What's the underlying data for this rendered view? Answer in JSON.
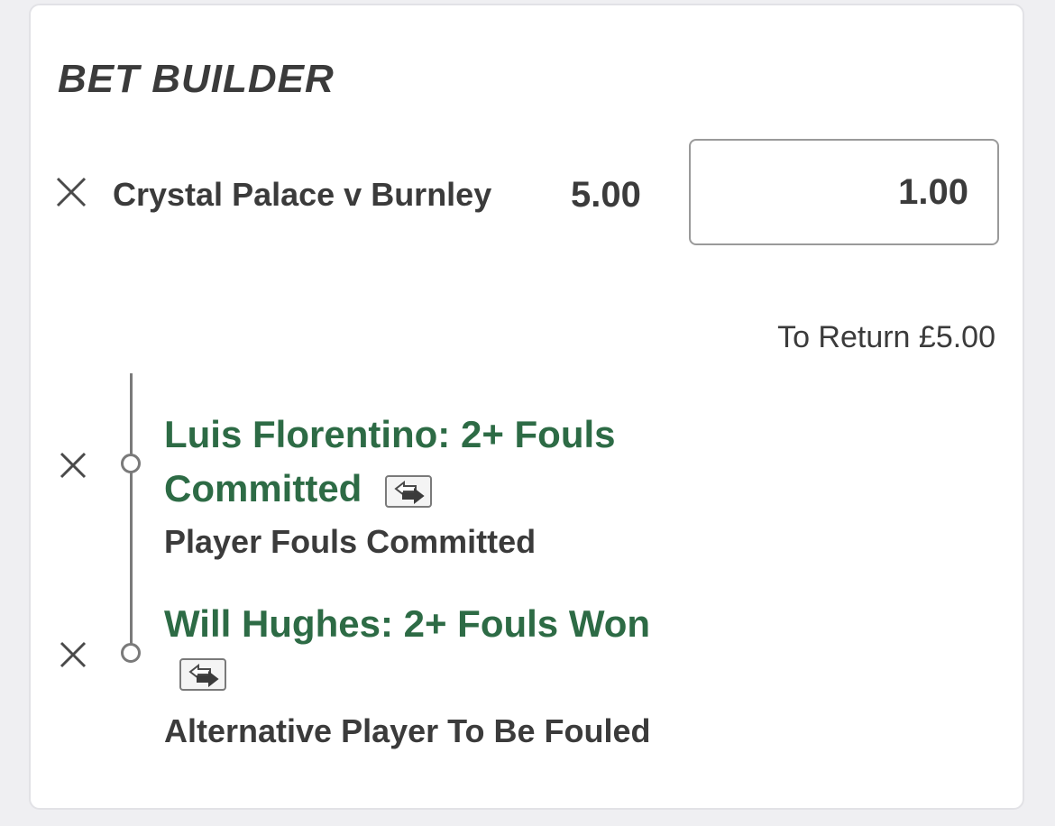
{
  "header": {
    "title": "BET BUILDER"
  },
  "bet": {
    "match": "Crystal Palace v Burnley",
    "odds": "5.00",
    "stake": "1.00",
    "to_return": "To Return £5.00"
  },
  "selections": [
    {
      "title_line1": "Luis Florentino: 2+ Fouls",
      "title_line2": "Committed",
      "market": "Player Fouls Committed"
    },
    {
      "title_line1": "Will Hughes: 2+ Fouls Won",
      "market": "Alternative Player To Be Fouled"
    }
  ],
  "icons": {
    "remove": "close-icon",
    "swap": "swap-arrows-icon"
  },
  "colors": {
    "selection_green": "#2d6b45",
    "text_dark": "#3b3b3b",
    "background": "#efeff2",
    "card": "#ffffff"
  }
}
